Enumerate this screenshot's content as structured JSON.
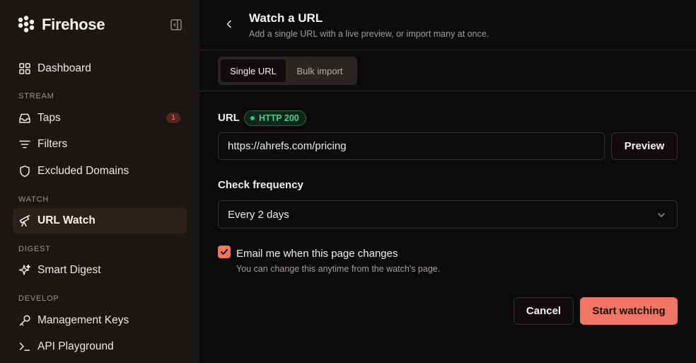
{
  "app": {
    "name": "Firehose"
  },
  "sidebar": {
    "dashboard": "Dashboard",
    "sections": {
      "stream": "STREAM",
      "watch": "WATCH",
      "digest": "DIGEST",
      "develop": "DEVELOP"
    },
    "items": {
      "taps": {
        "label": "Taps",
        "badge": "1"
      },
      "filters": {
        "label": "Filters"
      },
      "excluded_domains": {
        "label": "Excluded Domains"
      },
      "url_watch": {
        "label": "URL Watch",
        "active": true
      },
      "smart_digest": {
        "label": "Smart Digest"
      },
      "management_keys": {
        "label": "Management Keys"
      },
      "api_playground": {
        "label": "API Playground"
      }
    }
  },
  "header": {
    "title": "Watch a URL",
    "subtitle": "Add a single URL with a live preview, or import many at once."
  },
  "tabs": [
    {
      "label": "Single URL",
      "active": true
    },
    {
      "label": "Bulk import",
      "active": false
    }
  ],
  "form": {
    "url_label": "URL",
    "status": "HTTP 200",
    "url_value": "https://ahrefs.com/pricing",
    "preview_label": "Preview",
    "frequency_label": "Check frequency",
    "frequency_value": "Every 2 days",
    "email_label": "Email me when this page changes",
    "email_help": "You can change this anytime from the watch's page.",
    "email_checked": true,
    "cancel_label": "Cancel",
    "submit_label": "Start watching"
  },
  "colors": {
    "accent": "#f07563",
    "status_green": "#3fcf88",
    "sidebar_bg": "#1a1614",
    "main_bg": "#0d0b0a"
  }
}
